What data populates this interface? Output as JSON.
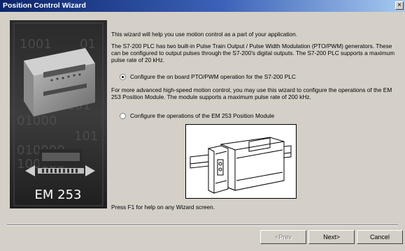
{
  "window": {
    "title": "Position Control Wizard",
    "close_glyph": "×"
  },
  "side_panel": {
    "binary_rows": [
      "1001",
      "01",
      "1",
      "0101",
      "01000",
      "101",
      "010000",
      "100100",
      "0101"
    ],
    "product_label": "EM 253"
  },
  "content": {
    "intro": "This wizard will help you use motion control as a part of your application.",
    "description": "The S7-200 PLC has two built-in Pulse Train Output / Pulse Width Modulation (PTO/PWM) generators.  These can be configured to output pulses through the S7-200's digital outputs. The S7-200 PLC supports a maximum pulse rate of 20 kHz.",
    "option_onboard": "Configure the on board PTO/PWM operation for the S7-200 PLC",
    "advanced_text": "For more advanced high-speed motion control, you may use this wizard to configure the operations of the EM 253 Position Module. The module supports a maximum pulse rate of 200 kHz.",
    "option_em253": "Configure the operations of the EM 253 Position Module",
    "help_text": "Press F1 for help on any Wizard screen."
  },
  "buttons": {
    "prev": "<Prev",
    "next": "Next>",
    "cancel": "Cancel"
  },
  "selected_option": "onboard"
}
